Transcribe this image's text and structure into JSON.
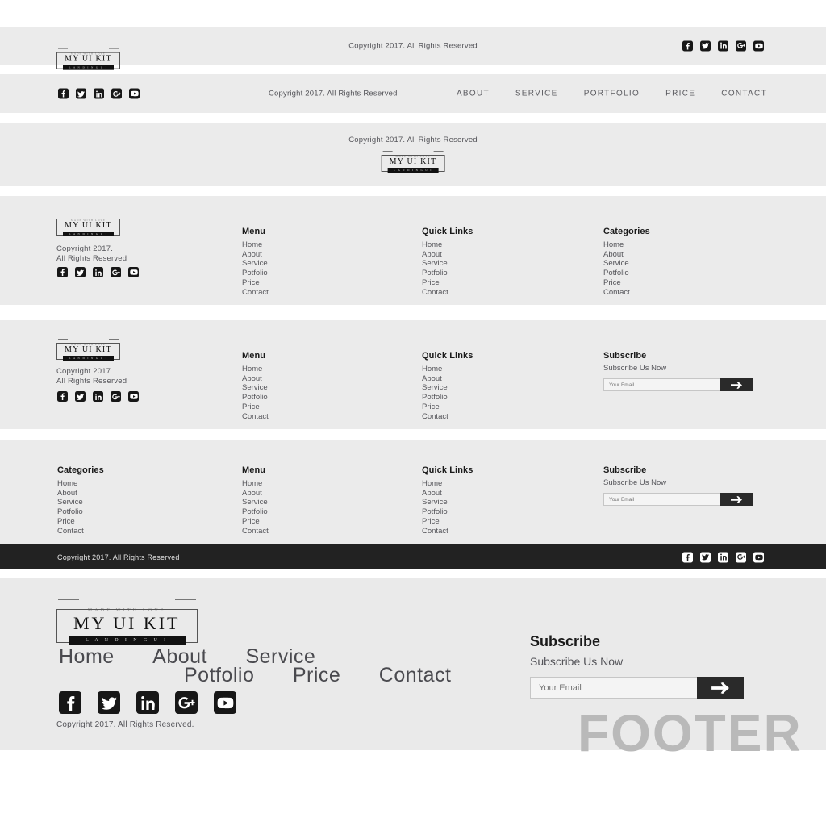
{
  "page": {
    "background": "#ffffff",
    "band_background": "#ebebeb",
    "dark_band_background": "#222222",
    "accent": "#1b1b1b",
    "watermark_label": "FOOTER",
    "watermark_color": "#b9b9b9"
  },
  "logo": {
    "tagline": "MADE WITH LOVE",
    "name": "MY UI KIT",
    "sub": "L A N D I N G   U I"
  },
  "social": {
    "items": [
      {
        "name": "facebook-icon",
        "label": "Facebook"
      },
      {
        "name": "twitter-icon",
        "label": "Twitter"
      },
      {
        "name": "linkedin-icon",
        "label": "LinkedIn"
      },
      {
        "name": "googleplus-icon",
        "label": "Google Plus"
      },
      {
        "name": "youtube-icon",
        "label": "YouTube"
      }
    ]
  },
  "copyright": {
    "inline": "Copyright 2017. All Rights Reserved",
    "inline_spaced": "Copyright 2017.  All Rights Reserved",
    "line1": "Copyright 2017.",
    "line2": "All Rights Reserved",
    "with_period": "Copyright 2017. All Rights Reserved."
  },
  "nav_caps": {
    "items": [
      "ABOUT",
      "SERVICE",
      "PORTFOLIO",
      "PRICE",
      "CONTACT"
    ]
  },
  "link_columns": {
    "menu": {
      "heading": "Menu",
      "links": [
        "Home",
        "About",
        "Service",
        "Potfolio",
        "Price",
        "Contact"
      ]
    },
    "quick_links": {
      "heading": "Quick Links",
      "links": [
        "Home",
        "About",
        "Service",
        "Potfolio",
        "Price",
        "Contact"
      ]
    },
    "categories": {
      "heading": "Categories",
      "links": [
        "Home",
        "About",
        "Service",
        "Potfolio",
        "Price",
        "Contact"
      ]
    }
  },
  "subscribe": {
    "heading": "Subscribe",
    "description": "Subscribe Us Now",
    "placeholder": "Your Email",
    "value": "",
    "button_icon": "send-icon"
  },
  "big_nav": {
    "row1": [
      "Home",
      "About",
      "Service"
    ],
    "row2": [
      "Potfolio",
      "Price",
      "Contact"
    ]
  }
}
